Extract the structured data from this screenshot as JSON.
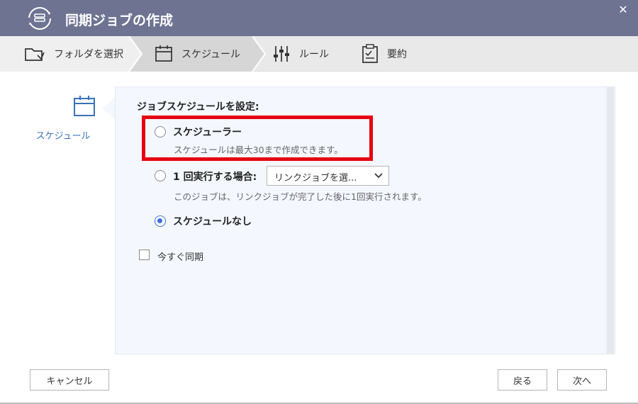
{
  "window": {
    "title": "同期ジョブの作成",
    "close_glyph": "✕"
  },
  "steps": [
    {
      "label": "フォルダを選択",
      "icon": "folder-select-icon"
    },
    {
      "label": "スケジュール",
      "icon": "calendar-icon",
      "active": true
    },
    {
      "label": "ルール",
      "icon": "sliders-icon"
    },
    {
      "label": "要約",
      "icon": "clipboard-icon"
    }
  ],
  "left_nav": {
    "label": "スケジュール",
    "icon": "calendar-icon"
  },
  "schedule": {
    "section_title": "ジョブスケジュールを設定:",
    "options": [
      {
        "label": "スケジューラー",
        "description": "スケジュールは最大30まで作成できます。",
        "checked": false
      },
      {
        "label": "1 回実行する場合:",
        "description": "このジョブは、リンクジョブが完了した後に1回実行されます。",
        "checked": false
      },
      {
        "label": "スケジュールなし",
        "checked": true
      }
    ],
    "link_job_select": {
      "value": "リンクジョブを選..."
    },
    "sync_now": {
      "label": "今すぐ同期",
      "checked": false
    }
  },
  "buttons": {
    "cancel": "キャンセル",
    "back": "戻る",
    "next": "次へ"
  },
  "colors": {
    "titlebar": "#6d7391",
    "accent": "#3a6fe0",
    "highlight": "#e60012",
    "nav_text": "#3a72b8"
  }
}
